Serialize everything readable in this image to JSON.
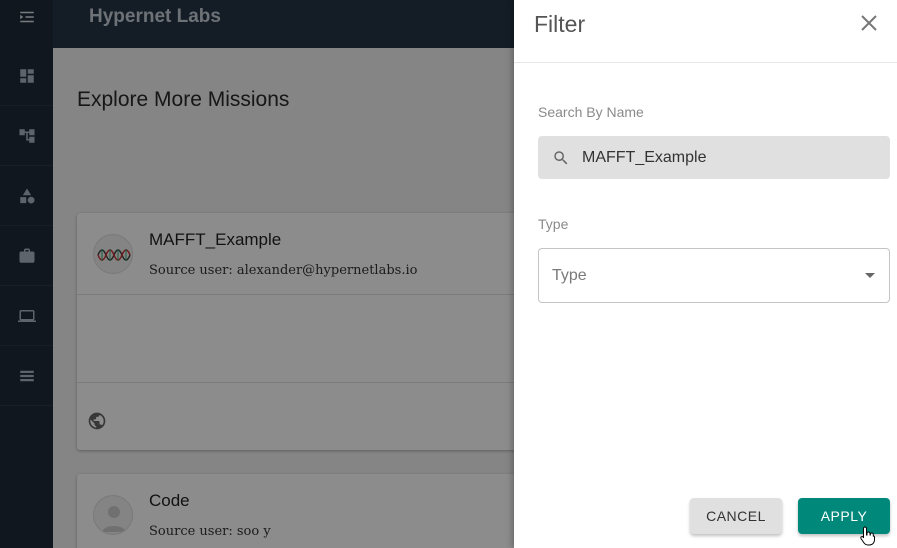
{
  "app": {
    "brand": "Hypernet Labs"
  },
  "sidebar": {
    "items": [
      {
        "icon": "menu-collapse-icon"
      },
      {
        "icon": "dashboard-icon"
      },
      {
        "icon": "hierarchy-icon"
      },
      {
        "icon": "shapes-icon"
      },
      {
        "icon": "briefcase-icon"
      },
      {
        "icon": "laptop-icon"
      },
      {
        "icon": "list-icon"
      }
    ]
  },
  "main": {
    "title": "Explore More Missions",
    "cards": [
      {
        "title": "MAFFT_Example",
        "source": "Source user: alexander@hypernetlabs.io"
      },
      {
        "title": "Code",
        "source": "Source user: soo y"
      }
    ]
  },
  "filter": {
    "title": "Filter",
    "search_label": "Search By Name",
    "search_value": "MAFFT_Example",
    "type_label": "Type",
    "type_placeholder": "Type",
    "cancel_label": "CANCEL",
    "apply_label": "APPLY"
  },
  "colors": {
    "sidebar": "#1f2a37",
    "topbar": "#253446",
    "apply": "#00897b"
  }
}
